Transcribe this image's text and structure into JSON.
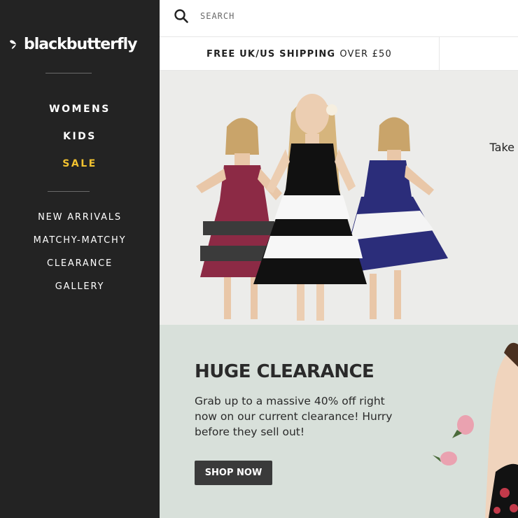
{
  "brand": {
    "logo_text": "blackbutterfly"
  },
  "sidebar": {
    "primary": [
      {
        "label": "WOMENS"
      },
      {
        "label": "KIDS"
      },
      {
        "label": "SALE"
      }
    ],
    "secondary": [
      {
        "label": "NEW ARRIVALS"
      },
      {
        "label": "MATCHY-MATCHY"
      },
      {
        "label": "CLEARANCE"
      },
      {
        "label": "GALLERY"
      }
    ]
  },
  "search": {
    "placeholder": "SEARCH",
    "icon": "search-icon"
  },
  "shipping": {
    "bold": "FREE UK/US SHIPPING",
    "light": "OVER £50"
  },
  "hero": {
    "side_text": "Take"
  },
  "promo": {
    "title": "HUGE CLEARANCE",
    "body": "Grab up to a massive 40% off right now on our current clearance! Hurry before they sell out!",
    "button": "SHOP NOW"
  },
  "colors": {
    "sidebar_bg": "#232323",
    "sale_accent": "#f2c230",
    "promo_bg": "#d8e0da",
    "button_bg": "#3a3a3a"
  }
}
